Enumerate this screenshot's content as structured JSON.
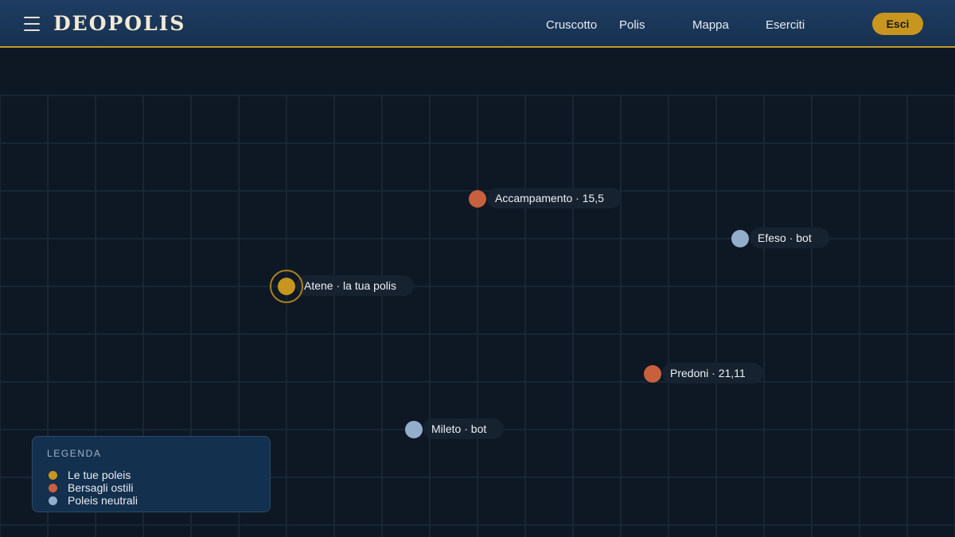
{
  "header": {
    "title": "DEOPOLIS",
    "nav": [
      {
        "label": "Cruscotto"
      },
      {
        "label": "Polis"
      },
      {
        "label": "Mappa"
      },
      {
        "label": "Eserciti"
      }
    ],
    "logout_label": "Esci",
    "menu_icon": "menu-icon"
  },
  "colors": {
    "own": "#c8961e",
    "hostile": "#c8603e",
    "neutral": "#93aecb",
    "accent": "#c39a2a",
    "header_bg": "#1e3d63"
  },
  "map": {
    "cities": [
      {
        "label": "Accampamento · 15,5",
        "kind": "hostile"
      },
      {
        "label": "Efeso · bot",
        "kind": "neutral"
      },
      {
        "label": "Atene · la tua polis",
        "kind": "own",
        "selected": true
      },
      {
        "label": "Predoni · 21,11",
        "kind": "hostile"
      },
      {
        "label": "Mileto · bot",
        "kind": "neutral"
      }
    ]
  },
  "legend": {
    "title": "LEGENDA",
    "items": [
      {
        "label": "Le tue poleis",
        "kind": "own"
      },
      {
        "label": "Bersagli ostili",
        "kind": "hostile"
      },
      {
        "label": "Poleis neutrali",
        "kind": "neutral"
      }
    ]
  }
}
